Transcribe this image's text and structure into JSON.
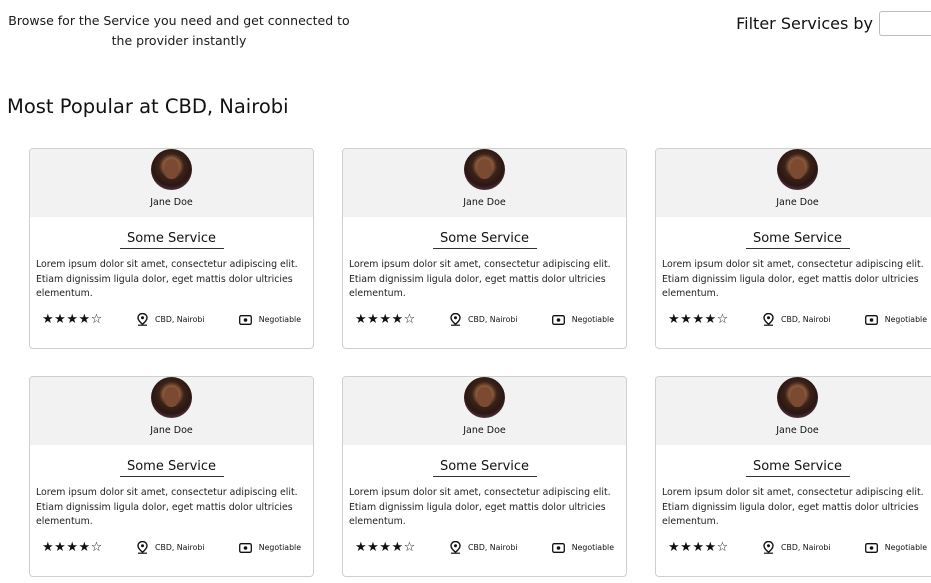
{
  "header": {
    "intro_line1": "Browse for the Service you need and get connected to",
    "intro_line2": "the provider instantly",
    "filter_label": "Filter Services by",
    "filter_value": ""
  },
  "section": {
    "title": "Most Popular at CBD, Nairobi"
  },
  "cards": [
    {
      "provider": "Jane Doe",
      "service": "Some Service",
      "description": "Lorem ipsum dolor sit amet, consectetur adipiscing elit. Etiam dignissim ligula dolor, eget mattis dolor ultricies elementum.",
      "rating": 4,
      "rating_max": 5,
      "location": "CBD, Nairobi",
      "price": "Negotiable"
    },
    {
      "provider": "Jane Doe",
      "service": "Some Service",
      "description": "Lorem ipsum dolor sit amet, consectetur adipiscing elit. Etiam dignissim ligula dolor, eget mattis dolor ultricies elementum.",
      "rating": 4,
      "rating_max": 5,
      "location": "CBD, Nairobi",
      "price": "Negotiable"
    },
    {
      "provider": "Jane Doe",
      "service": "Some Service",
      "description": "Lorem ipsum dolor sit amet, consectetur adipiscing elit. Etiam dignissim ligula dolor, eget mattis dolor ultricies elementum.",
      "rating": 4,
      "rating_max": 5,
      "location": "CBD, Nairobi",
      "price": "Negotiable"
    },
    {
      "provider": "Jane Doe",
      "service": "Some Service",
      "description": "Lorem ipsum dolor sit amet, consectetur adipiscing elit. Etiam dignissim ligula dolor, eget mattis dolor ultricies elementum.",
      "rating": 4,
      "rating_max": 5,
      "location": "CBD, Nairobi",
      "price": "Negotiable"
    },
    {
      "provider": "Jane Doe",
      "service": "Some Service",
      "description": "Lorem ipsum dolor sit amet, consectetur adipiscing elit. Etiam dignissim ligula dolor, eget mattis dolor ultricies elementum.",
      "rating": 4,
      "rating_max": 5,
      "location": "CBD, Nairobi",
      "price": "Negotiable"
    },
    {
      "provider": "Jane Doe",
      "service": "Some Service",
      "description": "Lorem ipsum dolor sit amet, consectetur adipiscing elit. Etiam dignissim ligula dolor, eget mattis dolor ultricies elementum.",
      "rating": 4,
      "rating_max": 5,
      "location": "CBD, Nairobi",
      "price": "Negotiable"
    }
  ],
  "icons": {
    "rating": "star-icon",
    "location": "location-pin-icon",
    "price": "cash-icon"
  }
}
